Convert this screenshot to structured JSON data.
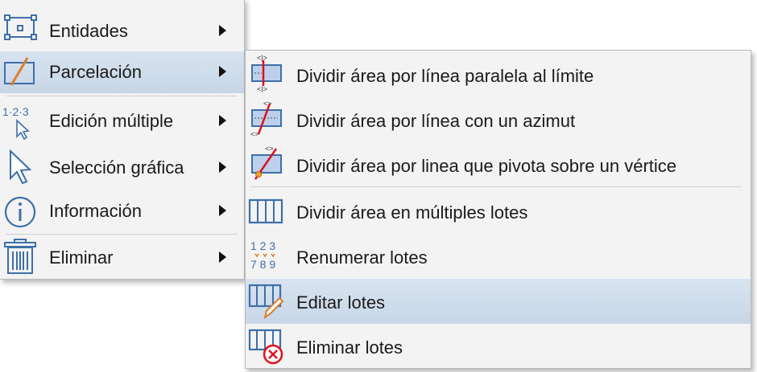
{
  "main_menu": {
    "items": [
      {
        "label": "Entidades",
        "icon": "entities-icon"
      },
      {
        "label": "Parcelación",
        "icon": "parcel-icon"
      },
      {
        "label": "Edición múltiple",
        "icon": "multi-edit-icon"
      },
      {
        "label": "Selección gráfica",
        "icon": "pointer-icon"
      },
      {
        "label": "Información",
        "icon": "info-icon"
      },
      {
        "label": "Eliminar",
        "icon": "trash-icon"
      }
    ],
    "highlighted": "Parcelación"
  },
  "sub_menu": {
    "items": [
      {
        "label": "Dividir área por línea paralela al límite",
        "icon": "divide-parallel-icon"
      },
      {
        "label": "Dividir área por línea con un azimut",
        "icon": "divide-azimuth-icon"
      },
      {
        "label": "Dividir área por linea que pivota sobre un vértice",
        "icon": "divide-pivot-icon"
      },
      {
        "label": "Dividir área en múltiples lotes",
        "icon": "multiple-lots-icon"
      },
      {
        "label": "Renumerar lotes",
        "icon": "renumber-lots-icon",
        "icon_text_top": "1 2 3",
        "icon_text_bottom": "7 8 9"
      },
      {
        "label": "Editar lotes",
        "icon": "edit-lots-icon"
      },
      {
        "label": "Eliminar lotes",
        "icon": "delete-lots-icon"
      }
    ],
    "highlighted": "Editar lotes"
  },
  "multi_edit_icon_text": "1·2·3",
  "colors": {
    "menu_bg": "#f3f3f3",
    "highlight": "#c9d8e8",
    "icon_blue": "#3d6fa8",
    "accent_red": "#e0101a",
    "accent_orange": "#e07b2a"
  }
}
